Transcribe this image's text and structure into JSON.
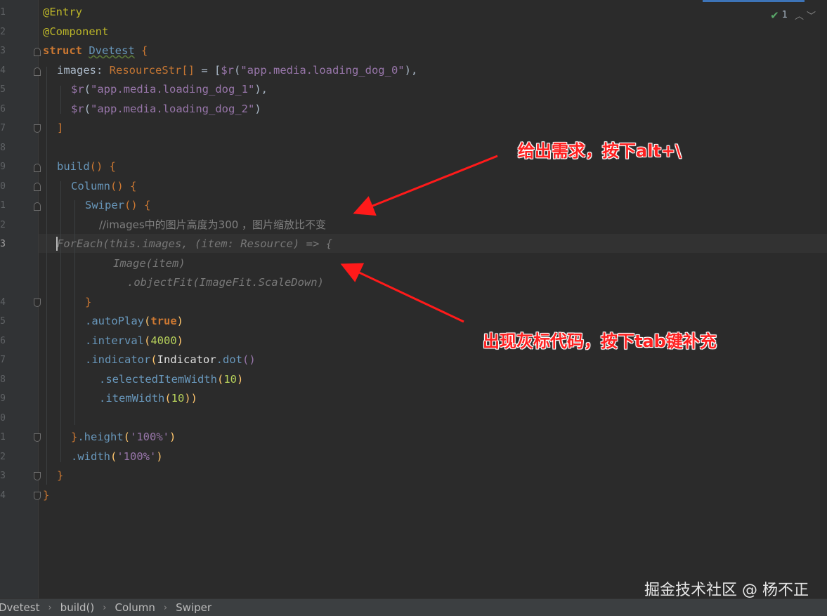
{
  "editor": {
    "line_numbers": [
      "1",
      "2",
      "3",
      "4",
      "5",
      "6",
      "7",
      "8",
      "9",
      "0",
      "1",
      "2",
      "3",
      "",
      "",
      "4",
      "5",
      "6",
      "7",
      "8",
      "9",
      "0",
      "1",
      "2",
      "3",
      "4"
    ],
    "current_line_number": "3",
    "lines": {
      "l1": "@Entry",
      "l2": "@Component",
      "l3_kw": "struct",
      "l3_name": "Dvetest",
      "l3_brace": " {",
      "l4_field": "images",
      "l4_colon": ": ",
      "l4_type": "ResourceStr[]",
      "l4_eq": " = [",
      "l4_fn": "$r",
      "l4_str": "\"app.media.loading_dog_0\"",
      "l4_end": "),",
      "l5_fn": "$r",
      "l5_str": "\"app.media.loading_dog_1\"",
      "l5_end": "),",
      "l6_fn": "$r",
      "l6_str": "\"app.media.loading_dog_2\"",
      "l6_end": ")",
      "l7": "]",
      "l9_fn": "build",
      "l9_rest": "() {",
      "l10_fn": "Column",
      "l10_rest": "() {",
      "l11_fn": "Swiper",
      "l11_rest": "() {",
      "l12_comment": "//images中的图片高度为300 ，图片缩放比不变",
      "ghost1": "ForEach(this.images, (item: Resource) => {",
      "ghost2": "Image(item)",
      "ghost3": ".objectFit(ImageFit.ScaleDown)",
      "l14": "}",
      "l15_fn": ".autoPlay",
      "l15_arg": "true",
      "l16_fn": ".interval",
      "l16_arg": "4000",
      "l17_fn": ".indicator",
      "l17_cls": "Indicator",
      "l17_m": ".dot",
      "l18_fn": ".selectedItemWidth",
      "l18_arg": "10",
      "l19_fn": ".itemWidth",
      "l19_arg": "10",
      "l21_brace": "}",
      "l21_fn": ".height",
      "l21_arg": "'100%'",
      "l22_fn": ".width",
      "l22_arg": "'100%'",
      "l23": "}",
      "l24": "}"
    },
    "inspection_count": "1"
  },
  "breadcrumbs": [
    "Dvetest",
    "build()",
    "Column",
    "Swiper"
  ],
  "annotations": {
    "top": "给出需求，按下alt+\\",
    "bottom": "出现灰标代码，按下tab键补充"
  },
  "watermark": "掘金技术社区 @ 杨不正",
  "colors": {
    "background": "#2b2b2b",
    "gutter": "#313335",
    "annotation_red": "#ff2020",
    "keyword": "#cc7832",
    "string": "#6a8759",
    "function": "#ffc66d",
    "number": "#6897bb",
    "ghost_text": "#787878"
  }
}
